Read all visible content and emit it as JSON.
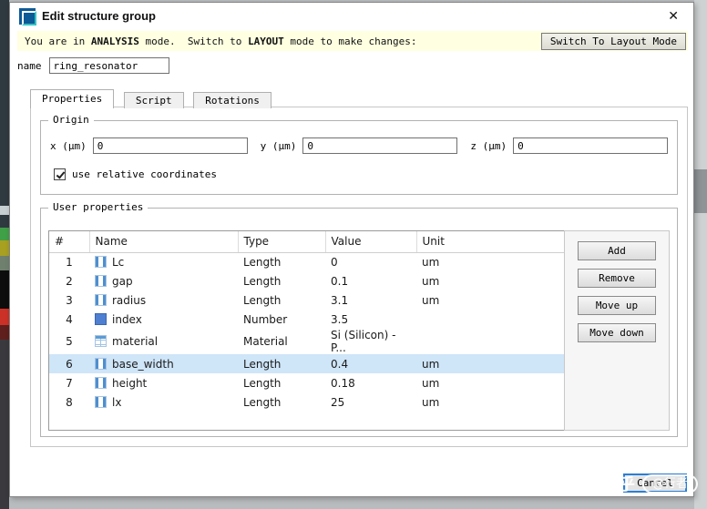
{
  "window": {
    "title": "Edit structure group",
    "close_icon": "✕"
  },
  "banner": {
    "part1": "You are in ",
    "mode1": "ANALYSIS",
    "part2": " mode.  Switch to ",
    "mode2": "LAYOUT",
    "part3": " mode to make changes:",
    "button": "Switch To Layout Mode"
  },
  "name_field": {
    "label": "name",
    "value": "ring_resonator"
  },
  "tabs": [
    {
      "label": "Properties"
    },
    {
      "label": "Script"
    },
    {
      "label": "Rotations"
    }
  ],
  "origin": {
    "legend": "Origin",
    "fields": [
      {
        "label": "x (μm)",
        "value": "0"
      },
      {
        "label": "y (μm)",
        "value": "0"
      },
      {
        "label": "z (μm)",
        "value": "0"
      }
    ],
    "checkbox_label": "use relative coordinates",
    "checkbox_checked": true
  },
  "user_properties": {
    "legend": "User properties",
    "columns": [
      "#",
      "Name",
      "Type",
      "Value",
      "Unit"
    ],
    "selected_row": 6,
    "rows": [
      {
        "num": "1",
        "icon": "length",
        "name": "Lc",
        "type": "Length",
        "value": "0",
        "unit": "um"
      },
      {
        "num": "2",
        "icon": "length",
        "name": "gap",
        "type": "Length",
        "value": "0.1",
        "unit": "um"
      },
      {
        "num": "3",
        "icon": "length",
        "name": "radius",
        "type": "Length",
        "value": "3.1",
        "unit": "um"
      },
      {
        "num": "4",
        "icon": "number",
        "name": "index",
        "type": "Number",
        "value": "3.5",
        "unit": ""
      },
      {
        "num": "5",
        "icon": "material",
        "name": "material",
        "type": "Material",
        "value": "Si (Silicon) - P...",
        "unit": ""
      },
      {
        "num": "6",
        "icon": "length",
        "name": "base_width",
        "type": "Length",
        "value": "0.4",
        "unit": "um"
      },
      {
        "num": "7",
        "icon": "length",
        "name": "height",
        "type": "Length",
        "value": "0.18",
        "unit": "um"
      },
      {
        "num": "8",
        "icon": "length",
        "name": "lx",
        "type": "Length",
        "value": "25",
        "unit": "um"
      }
    ],
    "buttons": [
      "Add",
      "Remove",
      "Move up",
      "Move down"
    ]
  },
  "footer": {
    "cancel_label": "Cancel"
  },
  "watermark": {
    "brand": "知乎",
    "handle": "@行者"
  }
}
